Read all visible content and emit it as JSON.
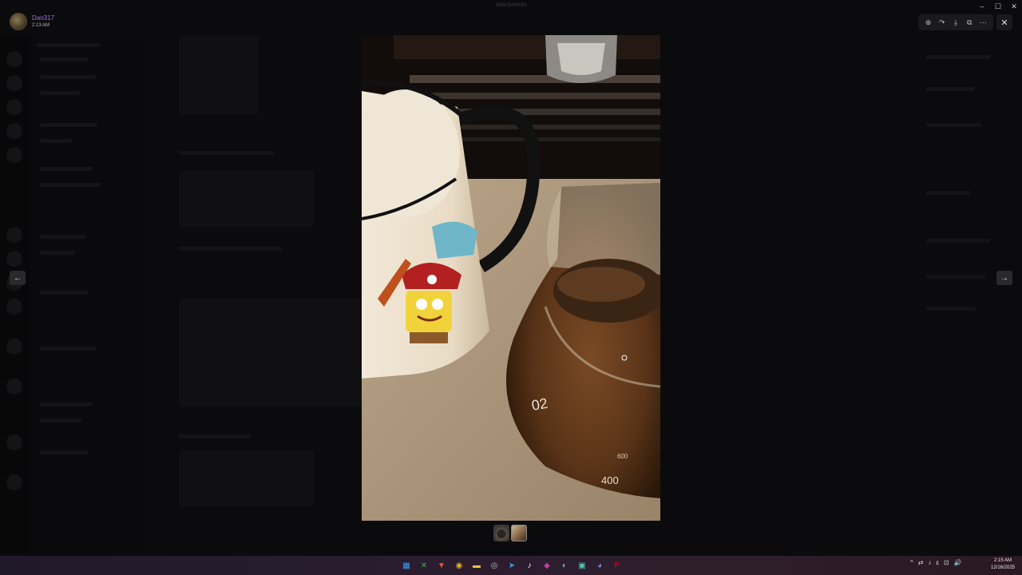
{
  "window": {
    "title": "Attachments",
    "controls": [
      "minimize",
      "maximize",
      "close"
    ]
  },
  "user": {
    "name": "Dan317",
    "time": "2:13 AM"
  },
  "viewer": {
    "toolbar": [
      {
        "icon": "zoom-in-icon",
        "glyph": "⊕"
      },
      {
        "icon": "forward-icon",
        "glyph": "↷"
      },
      {
        "icon": "download-icon",
        "glyph": "⤓"
      },
      {
        "icon": "open-external-icon",
        "glyph": "⧉"
      },
      {
        "icon": "more-icon",
        "glyph": "⋯"
      }
    ],
    "close_glyph": "✕",
    "prev_glyph": "←",
    "next_glyph": "→",
    "image_alt": "SpongeBob mug and coffee carafe",
    "carafe_text_1": "02",
    "carafe_text_2": "400",
    "carafe_text_3": "600",
    "thumbnails": [
      "thumbnail-1",
      "thumbnail-2"
    ]
  },
  "taskbar": {
    "icons": [
      {
        "name": "start-icon",
        "glyph": "▦",
        "color": "#3aa0ff"
      },
      {
        "name": "xbox-icon",
        "glyph": "✕",
        "color": "#3fb24f"
      },
      {
        "name": "brave-icon",
        "glyph": "▼",
        "color": "#f0542d"
      },
      {
        "name": "chrome-icon",
        "glyph": "◉",
        "color": "#e5b52e"
      },
      {
        "name": "file-explorer-icon",
        "glyph": "▬",
        "color": "#f3c043"
      },
      {
        "name": "app-icon",
        "glyph": "◎",
        "color": "#bbbbbb"
      },
      {
        "name": "telegram-icon",
        "glyph": "➤",
        "color": "#37a3e3"
      },
      {
        "name": "tiktok-icon",
        "glyph": "♪",
        "color": "#ffffff"
      },
      {
        "name": "notes-icon",
        "glyph": "◆",
        "color": "#c03ca0"
      },
      {
        "name": "steam-icon",
        "glyph": "◐",
        "color": "#6fa8dc"
      },
      {
        "name": "app2-icon",
        "glyph": "▣",
        "color": "#4ec9b0"
      },
      {
        "name": "discord-icon",
        "glyph": "◕",
        "color": "#7289da"
      },
      {
        "name": "pinterest-icon",
        "glyph": "P",
        "color": "#e60023"
      }
    ],
    "tray": [
      "^",
      "⇄",
      "♪",
      "ε",
      "⊡",
      "🔊"
    ],
    "clock_time": "2:15 AM",
    "clock_date": "12/16/2025"
  }
}
